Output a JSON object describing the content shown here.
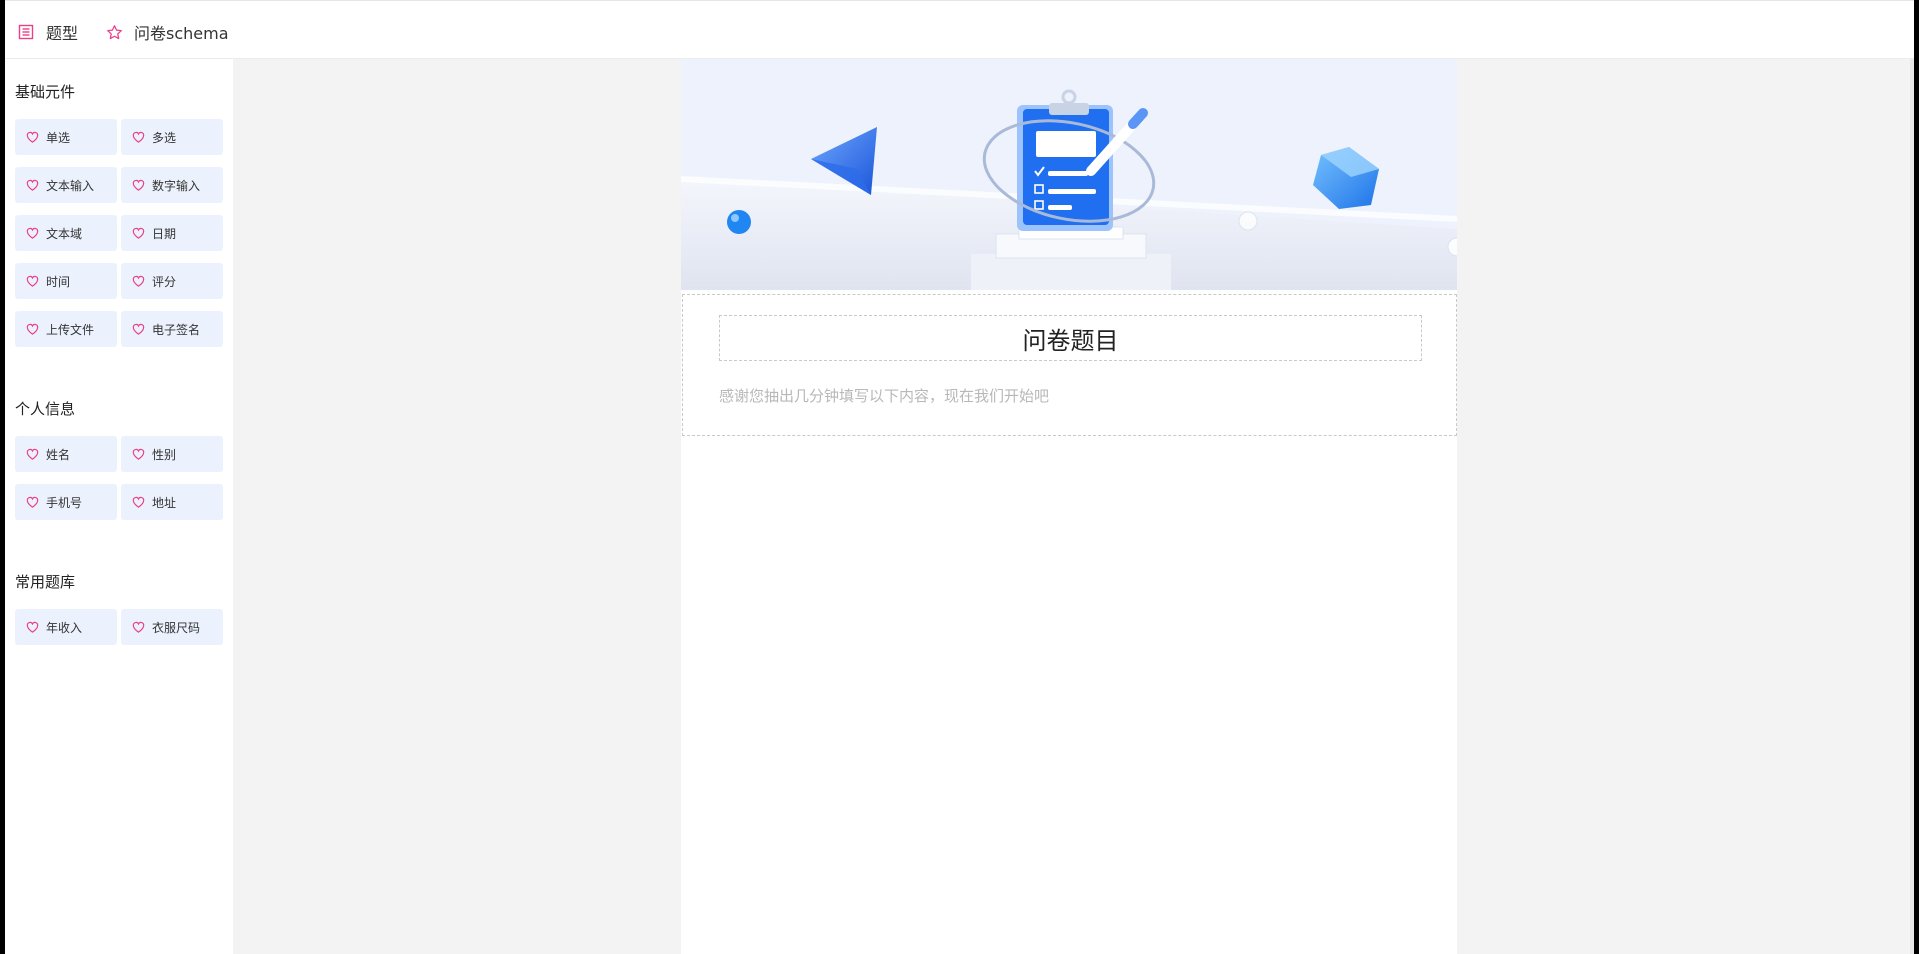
{
  "topbar": {
    "tabs": [
      {
        "label": "题型",
        "icon": "list-icon"
      },
      {
        "label": "问卷schema",
        "icon": "star-icon"
      }
    ]
  },
  "sidebar": {
    "groups": [
      {
        "title": "基础元件",
        "items": [
          "单选",
          "多选",
          "文本输入",
          "数字输入",
          "文本域",
          "日期",
          "时间",
          "评分",
          "上传文件",
          "电子签名"
        ]
      },
      {
        "title": "个人信息",
        "items": [
          "姓名",
          "性别",
          "手机号",
          "地址"
        ]
      },
      {
        "title": "常用题库",
        "items": [
          "年收入",
          "衣服尺码"
        ]
      }
    ],
    "item_icon": "heart-icon"
  },
  "survey": {
    "title": "问卷题目",
    "description": "感谢您抽出几分钟填写以下内容，现在我们开始吧"
  },
  "colors": {
    "accent_pink": "#e8418a",
    "chip_bg": "#ecf2fd",
    "banner_blue": "#1f6ff0"
  }
}
